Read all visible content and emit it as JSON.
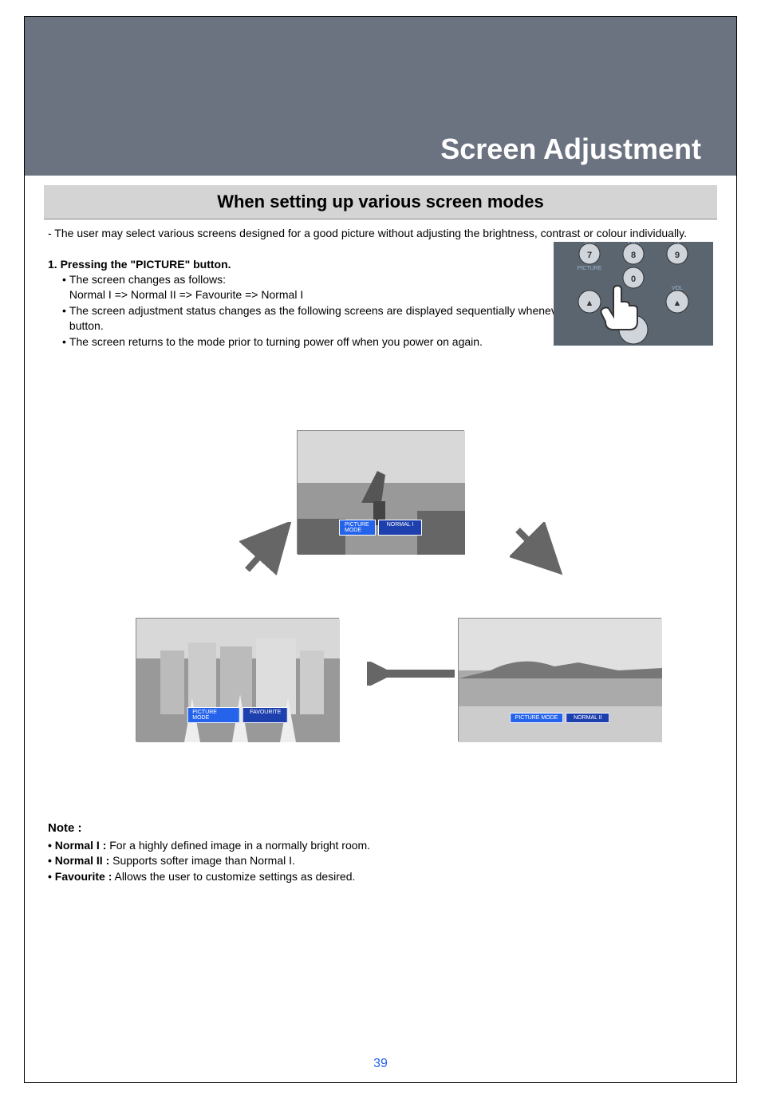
{
  "header": {
    "title": "Screen Adjustment"
  },
  "section": {
    "title": "When setting up various screen modes"
  },
  "intro": "- The user may select various screens designed for a good picture without adjusting the brightness, contrast or colour individually.",
  "step": {
    "heading": "1. Pressing the \"PICTURE\" button.",
    "items": [
      {
        "bullet": "•",
        "text": "The screen changes as follows:\nNormal I => Normal II => Favourite => Normal I"
      },
      {
        "bullet": "•",
        "text": "The screen adjustment status changes as the following screens are displayed sequentially whenever pressing the \"PICTURE\" button."
      },
      {
        "bullet": "•",
        "text": "The screen returns to the mode prior to turning power off when you power on again."
      }
    ]
  },
  "screens": {
    "top": {
      "label": "PICTURE MODE",
      "value": "NORMAL I"
    },
    "left": {
      "label": "PICTURE MODE",
      "value": "FAVOURITE"
    },
    "right": {
      "label": "PICTURE MODE",
      "value": "NORMAL II"
    }
  },
  "notes": {
    "heading": "Note :",
    "items": [
      {
        "label": "• Normal I :",
        "text": " For a highly defined image in a normally bright room."
      },
      {
        "label": "• Normal II :",
        "text": " Supports softer image than Normal I."
      },
      {
        "label": "• Favourite :",
        "text": " Allows the user to customize settings as desired."
      }
    ]
  },
  "page_number": "39"
}
